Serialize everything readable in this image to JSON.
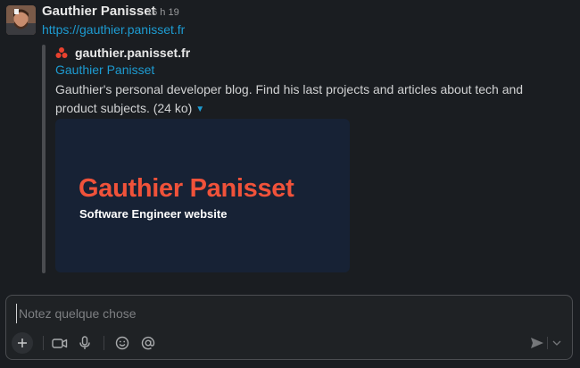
{
  "message": {
    "author": "Gauthier Panisset",
    "timestamp": "16 h 19",
    "link": "https://gauthier.panisset.fr"
  },
  "unfurl": {
    "site_name": "gauthier.panisset.fr",
    "title": "Gauthier Panisset",
    "description": "Gauthier's personal developer blog. Find his last projects and articles about tech and product subjects. (24 ko)",
    "preview_title": "Gauthier Panisset",
    "preview_subtitle": "Software Engineer website"
  },
  "composer": {
    "placeholder": "Notez quelque chose"
  },
  "icons": {
    "site_icon": "red-logo-icon",
    "desc_toggle": "caret-down-icon",
    "plus": "plus-icon",
    "video": "video-camera-icon",
    "mic": "microphone-icon",
    "emoji": "emoji-icon",
    "mention": "at-sign-icon",
    "send": "send-icon",
    "send_options": "chevron-down-icon"
  },
  "colors": {
    "background": "#1a1d21",
    "link": "#1d9bd1",
    "preview_bg": "#172235",
    "preview_accent": "#f0523a"
  }
}
